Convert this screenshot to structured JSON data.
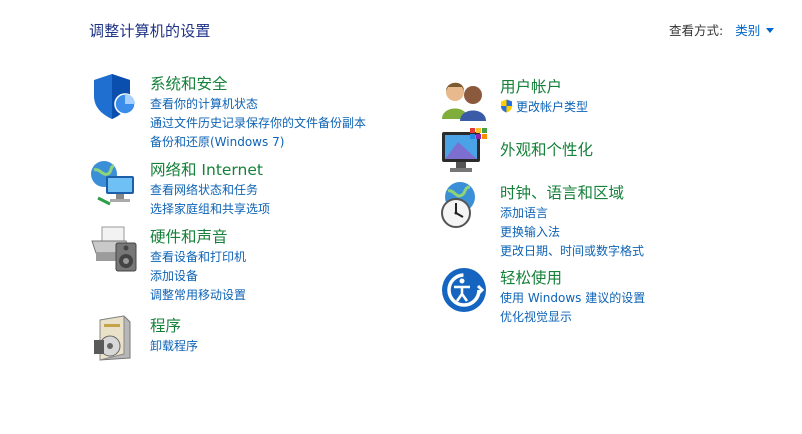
{
  "header": {
    "title": "调整计算机的设置",
    "view_by_label": "查看方式:",
    "view_by_value": "类别"
  },
  "categories": [
    {
      "title": "系统和安全",
      "icon": "shield-icon",
      "links": [
        "查看你的计算机状态",
        "通过文件历史记录保存你的文件备份副本",
        "备份和还原(Windows 7)"
      ]
    },
    {
      "title": "网络和 Internet",
      "icon": "network-globe-icon",
      "links": [
        "查看网络状态和任务",
        "选择家庭组和共享选项"
      ]
    },
    {
      "title": "硬件和声音",
      "icon": "printer-speaker-icon",
      "links": [
        "查看设备和打印机",
        "添加设备",
        "调整常用移动设置"
      ]
    },
    {
      "title": "程序",
      "icon": "programs-box-icon",
      "links": [
        "卸载程序"
      ]
    },
    {
      "title": "用户帐户",
      "icon": "users-icon",
      "links": [
        "更改帐户类型"
      ]
    },
    {
      "title": "外观和个性化",
      "icon": "monitor-personalize-icon",
      "links": []
    },
    {
      "title": "时钟、语言和区域",
      "icon": "clock-globe-icon",
      "links": [
        "添加语言",
        "更换输入法",
        "更改日期、时间或数字格式"
      ]
    },
    {
      "title": "轻松使用",
      "icon": "ease-of-access-icon",
      "links": [
        "使用 Windows 建议的设置",
        "优化视觉显示"
      ]
    }
  ]
}
